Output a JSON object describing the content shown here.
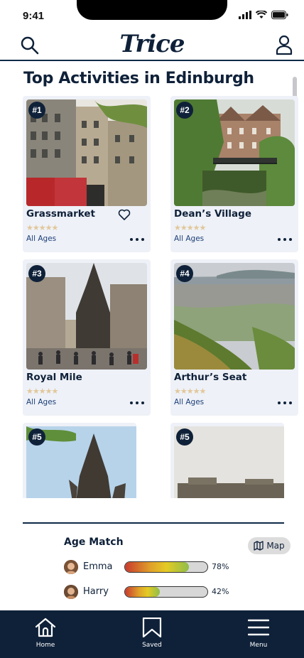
{
  "status": {
    "time": "9:41"
  },
  "header": {
    "logo": "Trice"
  },
  "page": {
    "title": "Top Activities in Edinburgh"
  },
  "cards": [
    {
      "rank": "#1",
      "name": "Grassmarket",
      "ages": "All Ages",
      "rating": 4.5
    },
    {
      "rank": "#2",
      "name": "Dean’s Village",
      "ages": "All Ages",
      "rating": 4.5
    },
    {
      "rank": "#3",
      "name": "Royal Mile",
      "ages": "All Ages",
      "rating": 4.5
    },
    {
      "rank": "#4",
      "name": "Arthur’s Seat",
      "ages": "All Ages",
      "rating": 4.5
    }
  ],
  "partial_cards": [
    {
      "rank": "#5"
    },
    {
      "rank": "#5"
    }
  ],
  "age_match": {
    "title": "Age Match",
    "map_label": "Map",
    "people": [
      {
        "name": "Emma",
        "percent_label": "78%",
        "fraction": 0.78
      },
      {
        "name": "Harry",
        "percent_label": "42%",
        "fraction": 0.42
      }
    ]
  },
  "tabs": [
    {
      "label": "Home",
      "icon": "home-icon"
    },
    {
      "label": "Saved",
      "icon": "bookmark-icon"
    },
    {
      "label": "Menu",
      "icon": "menu-icon"
    }
  ],
  "colors": {
    "navy": "#0f2139",
    "card_bg": "#eef1f7",
    "star": "#e2c79a",
    "link": "#1d3f78"
  }
}
